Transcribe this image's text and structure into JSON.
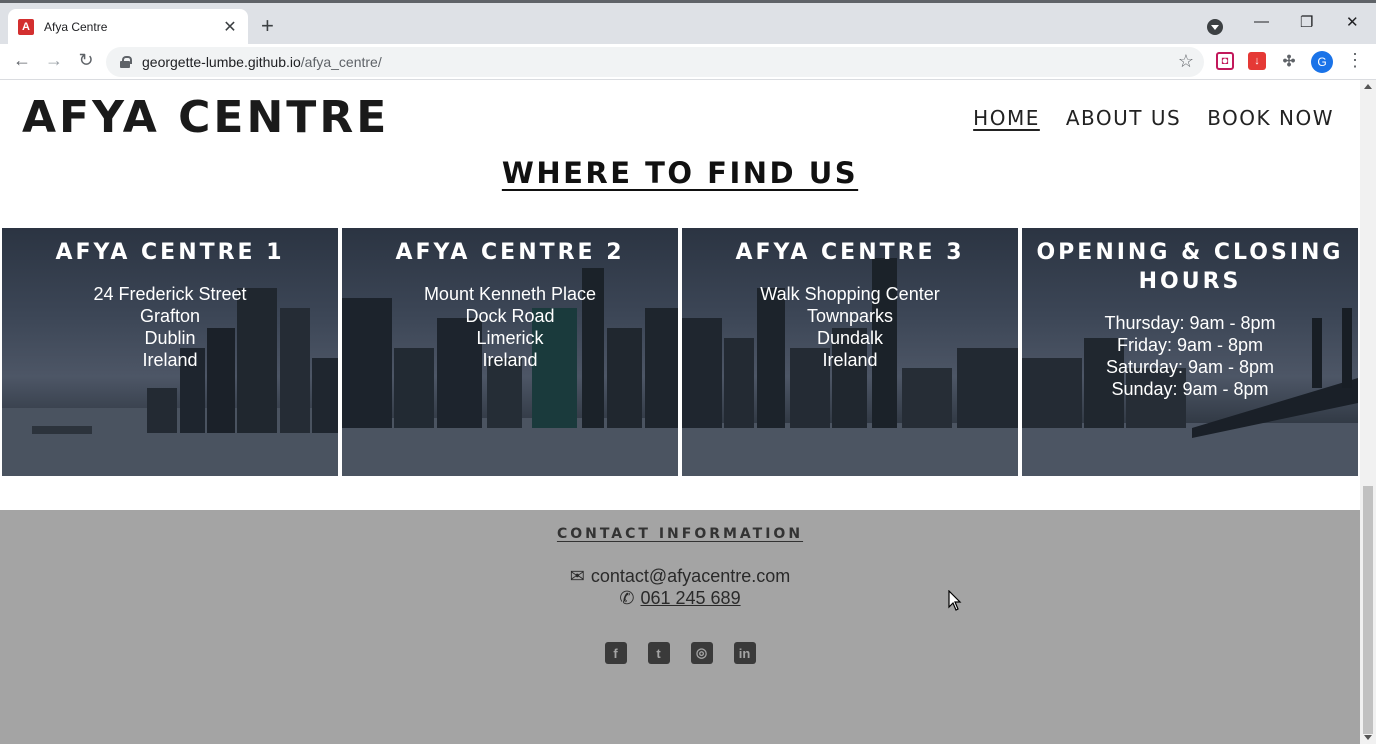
{
  "browser": {
    "tab_title": "Afya Centre",
    "tab_favicon_letter": "A",
    "url_host": "georgette-lumbe.github.io",
    "url_path": "/afya_centre/",
    "profile_letter": "G"
  },
  "header": {
    "logo": "AFYA CENTRE",
    "nav": [
      "HOME",
      "ABOUT US",
      "BOOK NOW"
    ]
  },
  "main": {
    "section_title": "WHERE TO FIND US",
    "cards": [
      {
        "title": "AFYA CENTRE 1",
        "lines": [
          "24 Frederick Street",
          "Grafton",
          "Dublin",
          "Ireland"
        ]
      },
      {
        "title": "AFYA CENTRE 2",
        "lines": [
          "Mount Kenneth Place",
          "Dock Road",
          "Limerick",
          "Ireland"
        ]
      },
      {
        "title": "AFYA CENTRE 3",
        "lines": [
          "Walk Shopping Center",
          "Townparks",
          "Dundalk",
          "Ireland"
        ]
      },
      {
        "title": "OPENING & CLOSING HOURS",
        "lines": [
          "Thursday: 9am - 8pm",
          "Friday: 9am - 8pm",
          "Saturday: 9am - 8pm",
          "Sunday: 9am - 8pm"
        ]
      }
    ]
  },
  "footer": {
    "title": "CONTACT INFORMATION",
    "email": "contact@afyacentre.com",
    "phone": "061 245 689",
    "socials": [
      "facebook-icon",
      "twitter-icon",
      "instagram-icon",
      "linkedin-icon"
    ]
  },
  "colors": {
    "footer_bg": "#a4a4a4",
    "card_overlay": "#3c4656"
  }
}
